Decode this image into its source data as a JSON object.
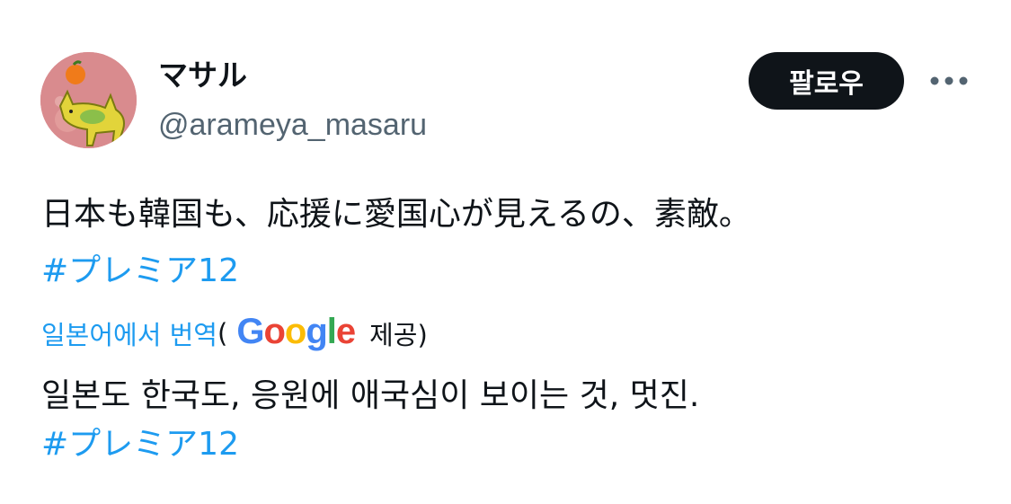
{
  "author": {
    "display_name": "マサル",
    "handle": "@arameya_masaru"
  },
  "actions": {
    "follow_label": "팔로우",
    "more_icon": "more-horizontal-icon"
  },
  "tweet": {
    "text": "日本も韓国も、応援に愛国心が見えるの、素敵。",
    "hashtag": "#プレミア12"
  },
  "translation": {
    "link_label": "일본어에서 번역",
    "paren_open": "(",
    "google_g1": "G",
    "google_o1": "o",
    "google_o2": "o",
    "google_g2": "g",
    "google_l": "l",
    "google_e": "e",
    "provided_label": "제공)",
    "text": "일본도 한국도, 응원에 애국심이 보이는 것, 멋진.",
    "hashtag": "#プレミア12"
  },
  "colors": {
    "link_blue": "#1d9bf0",
    "text_primary": "#0f1419",
    "text_secondary": "#536471",
    "button_bg": "#0f1419"
  }
}
